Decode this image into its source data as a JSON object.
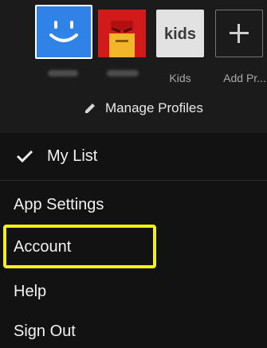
{
  "profiles": [
    {
      "name": "",
      "color": "#2f83e6",
      "avatar": "smiley-face",
      "selected": true
    },
    {
      "name": "",
      "color": "#d31a1a",
      "avatar": "red-character"
    },
    {
      "name": "Kids",
      "color": "#e2e2e2",
      "avatar": "kids-logo",
      "logo_text": "kids"
    },
    {
      "name": "Add Pr...",
      "avatar": "plus-icon"
    }
  ],
  "manage_profiles": {
    "label": "Manage Profiles",
    "icon": "pencil-icon"
  },
  "my_list": {
    "label": "My List",
    "icon": "checkmark-icon"
  },
  "menu": {
    "app_settings": "App Settings",
    "account": "Account",
    "help": "Help",
    "sign_out": "Sign Out"
  },
  "highlight_color": "#f5ef1c"
}
